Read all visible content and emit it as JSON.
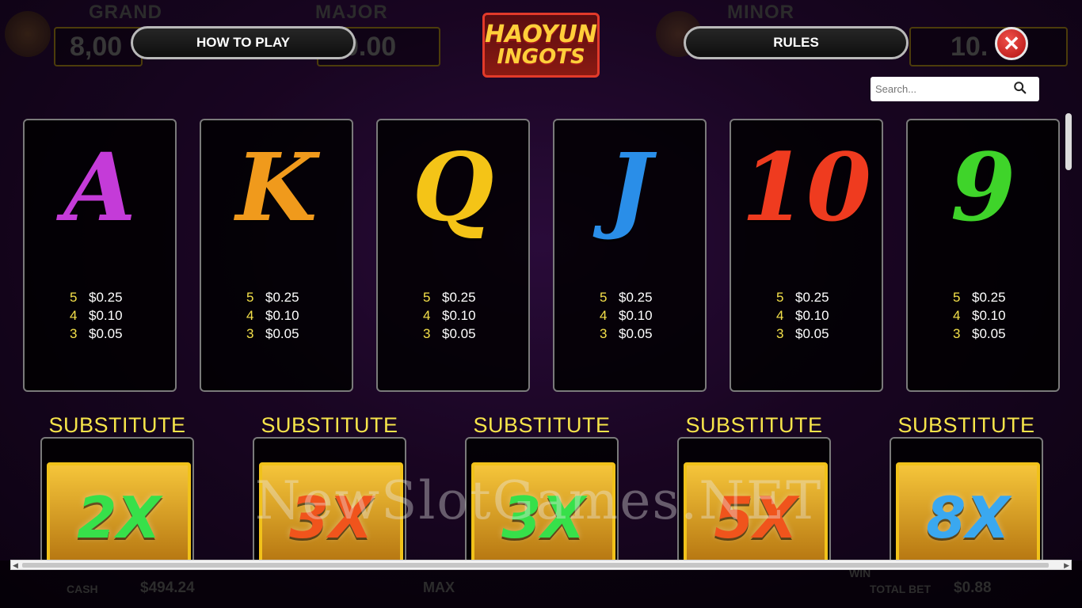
{
  "background": {
    "jackpots": [
      {
        "title": "GRAND",
        "value": "8,00"
      },
      {
        "title": "MAJOR",
        "value": "0.00"
      },
      {
        "title": "MINOR",
        "value": ""
      },
      {
        "title": "",
        "value": "10."
      }
    ],
    "cash_label": "CASH",
    "cash_value": "$494.24",
    "max_label": "MAX",
    "win_label": "WIN",
    "total_bet_label": "TOTAL BET",
    "total_bet_value": "$0.88"
  },
  "header": {
    "how_to_play_label": "HOW TO PLAY",
    "rules_label": "RULES",
    "logo_line1": "HAOYUN",
    "logo_line2": "INGOTS",
    "close_icon": "close-icon",
    "close_glyph": "✕"
  },
  "search": {
    "placeholder": "Search...",
    "icon": "search-icon"
  },
  "paytable": [
    {
      "symbol": "A",
      "color": "#c43bd8",
      "pays": [
        {
          "count": "5",
          "value": "$0.25"
        },
        {
          "count": "4",
          "value": "$0.10"
        },
        {
          "count": "3",
          "value": "$0.05"
        }
      ]
    },
    {
      "symbol": "K",
      "color": "#f09a1c",
      "pays": [
        {
          "count": "5",
          "value": "$0.25"
        },
        {
          "count": "4",
          "value": "$0.10"
        },
        {
          "count": "3",
          "value": "$0.05"
        }
      ]
    },
    {
      "symbol": "Q",
      "color": "#f4c417",
      "pays": [
        {
          "count": "5",
          "value": "$0.25"
        },
        {
          "count": "4",
          "value": "$0.10"
        },
        {
          "count": "3",
          "value": "$0.05"
        }
      ]
    },
    {
      "symbol": "J",
      "color": "#2a8ee8",
      "pays": [
        {
          "count": "5",
          "value": "$0.25"
        },
        {
          "count": "4",
          "value": "$0.10"
        },
        {
          "count": "3",
          "value": "$0.05"
        }
      ]
    },
    {
      "symbol": "10",
      "color": "#ef3b1f",
      "pays": [
        {
          "count": "5",
          "value": "$0.25"
        },
        {
          "count": "4",
          "value": "$0.10"
        },
        {
          "count": "3",
          "value": "$0.05"
        }
      ]
    },
    {
      "symbol": "9",
      "color": "#3fd42a",
      "pays": [
        {
          "count": "5",
          "value": "$0.25"
        },
        {
          "count": "4",
          "value": "$0.10"
        },
        {
          "count": "3",
          "value": "$0.05"
        }
      ]
    }
  ],
  "substitutes": [
    {
      "label": "SUBSTITUTE",
      "multiplier": "2X",
      "color": "#37e04a"
    },
    {
      "label": "SUBSTITUTE",
      "multiplier": "3X",
      "color": "#f0541c"
    },
    {
      "label": "SUBSTITUTE",
      "multiplier": "3X",
      "color": "#37e04a"
    },
    {
      "label": "SUBSTITUTE",
      "multiplier": "5X",
      "color": "#f0541c"
    },
    {
      "label": "SUBSTITUTE",
      "multiplier": "8X",
      "color": "#3aa8f0"
    }
  ],
  "watermark": "NewSlotGames.NET"
}
